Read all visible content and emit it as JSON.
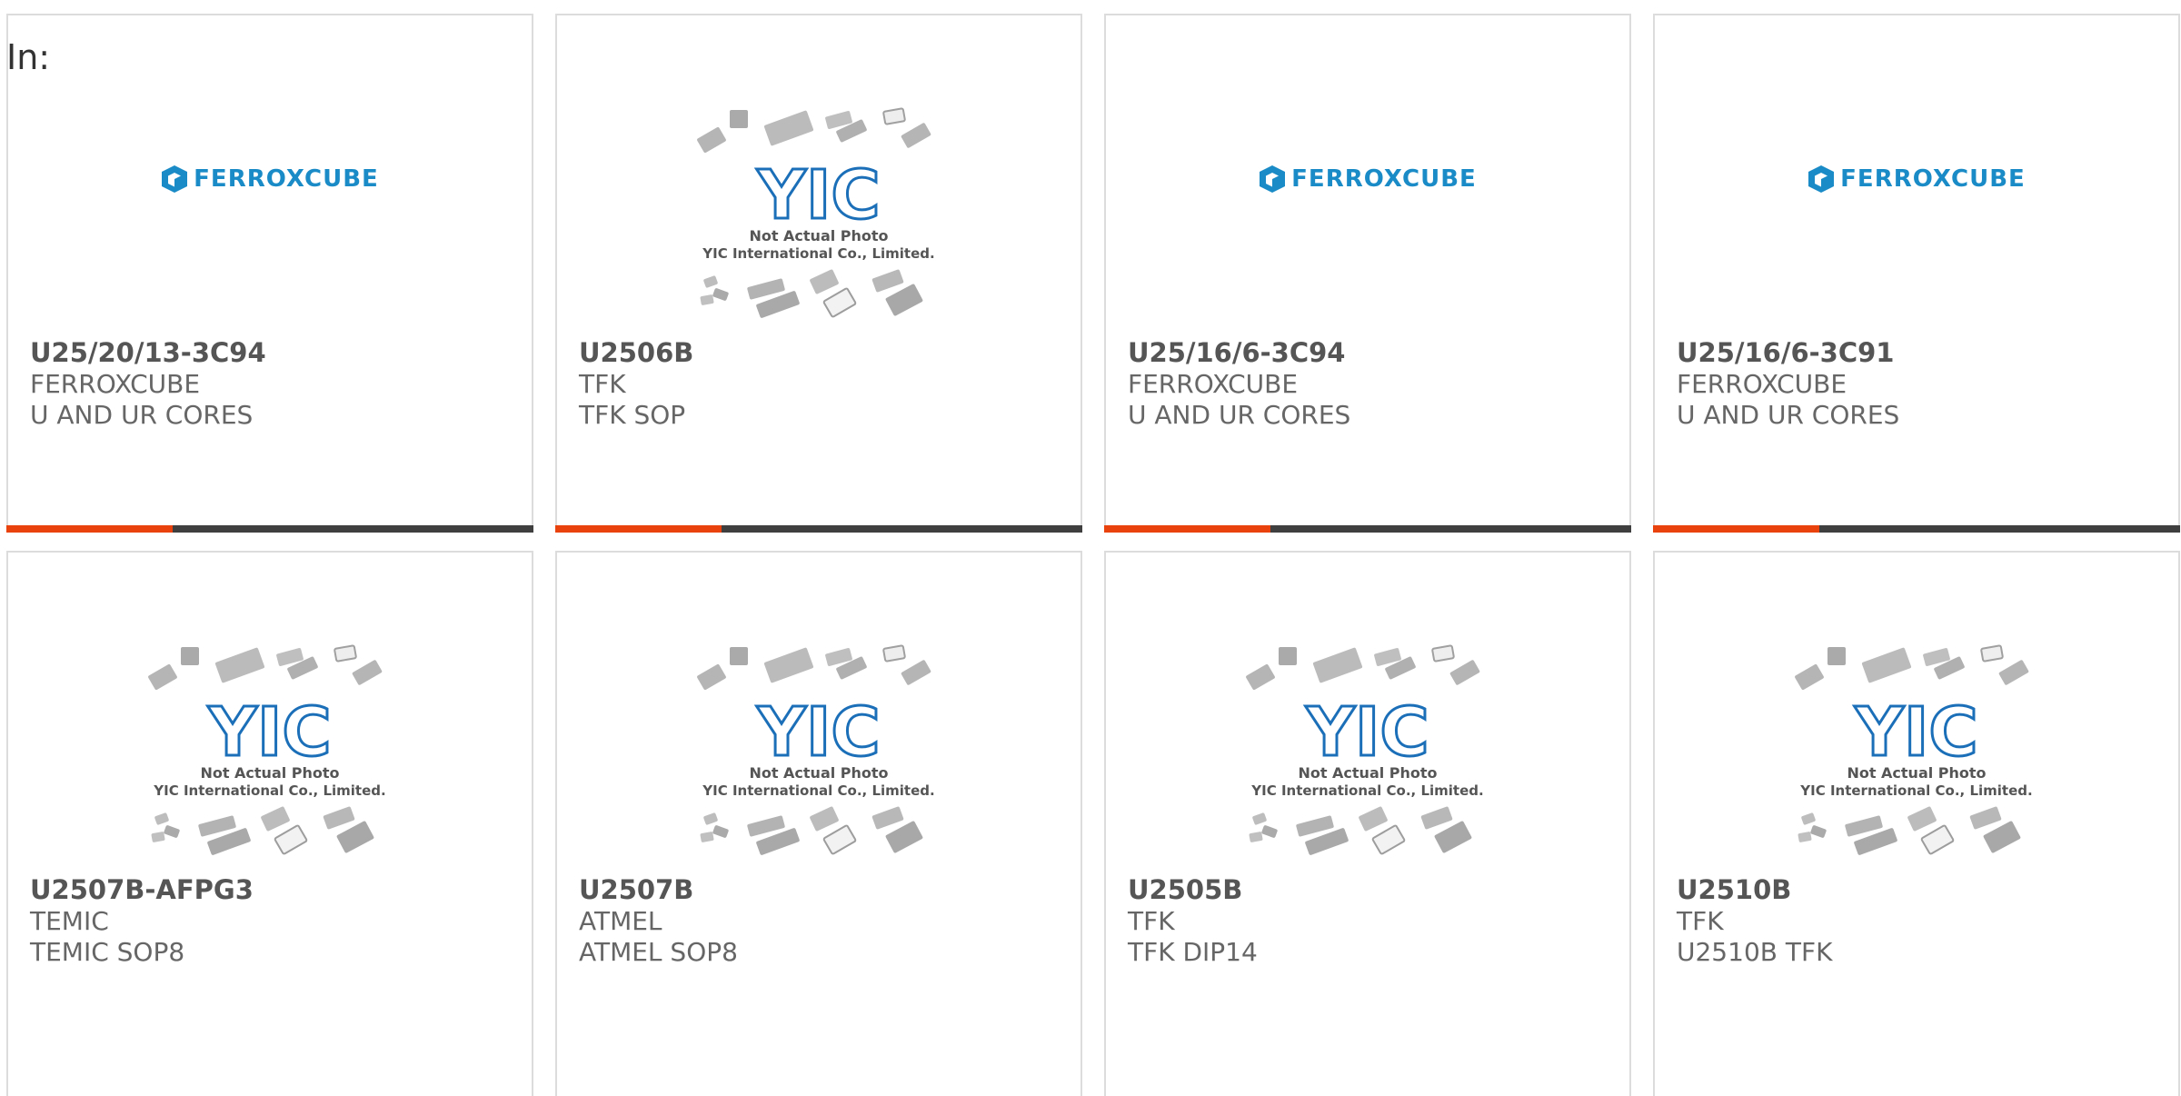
{
  "prefix": "In:",
  "colors": {
    "accent": "#e9420c",
    "bar_dark": "#3f3f3f",
    "logo_blue": "#1a8bc6"
  },
  "yic_placeholder": {
    "line1": "Not Actual Photo",
    "line2": "YIC International Co., Limited.",
    "logo": "YIC"
  },
  "ferrox_logo_text": "FERROXCUBE",
  "products": [
    {
      "name": "U25/20/13-3C94",
      "manufacturer": "FERROXCUBE",
      "description": "U AND UR CORES",
      "image": "ferroxcube-logo"
    },
    {
      "name": "U2506B",
      "manufacturer": "TFK",
      "description": "TFK SOP",
      "image": "yic-placeholder"
    },
    {
      "name": "U25/16/6-3C94",
      "manufacturer": "FERROXCUBE",
      "description": "U AND UR CORES",
      "image": "ferroxcube-logo"
    },
    {
      "name": "U25/16/6-3C91",
      "manufacturer": "FERROXCUBE",
      "description": "U AND UR CORES",
      "image": "ferroxcube-logo"
    },
    {
      "name": "U2507B-AFPG3",
      "manufacturer": "TEMIC",
      "description": "TEMIC SOP8",
      "image": "yic-placeholder"
    },
    {
      "name": "U2507B",
      "manufacturer": "ATMEL",
      "description": "ATMEL SOP8",
      "image": "yic-placeholder"
    },
    {
      "name": "U2505B",
      "manufacturer": "TFK",
      "description": "TFK DIP14",
      "image": "yic-placeholder"
    },
    {
      "name": "U2510B",
      "manufacturer": "TFK",
      "description": "U2510B TFK",
      "image": "yic-placeholder"
    }
  ]
}
